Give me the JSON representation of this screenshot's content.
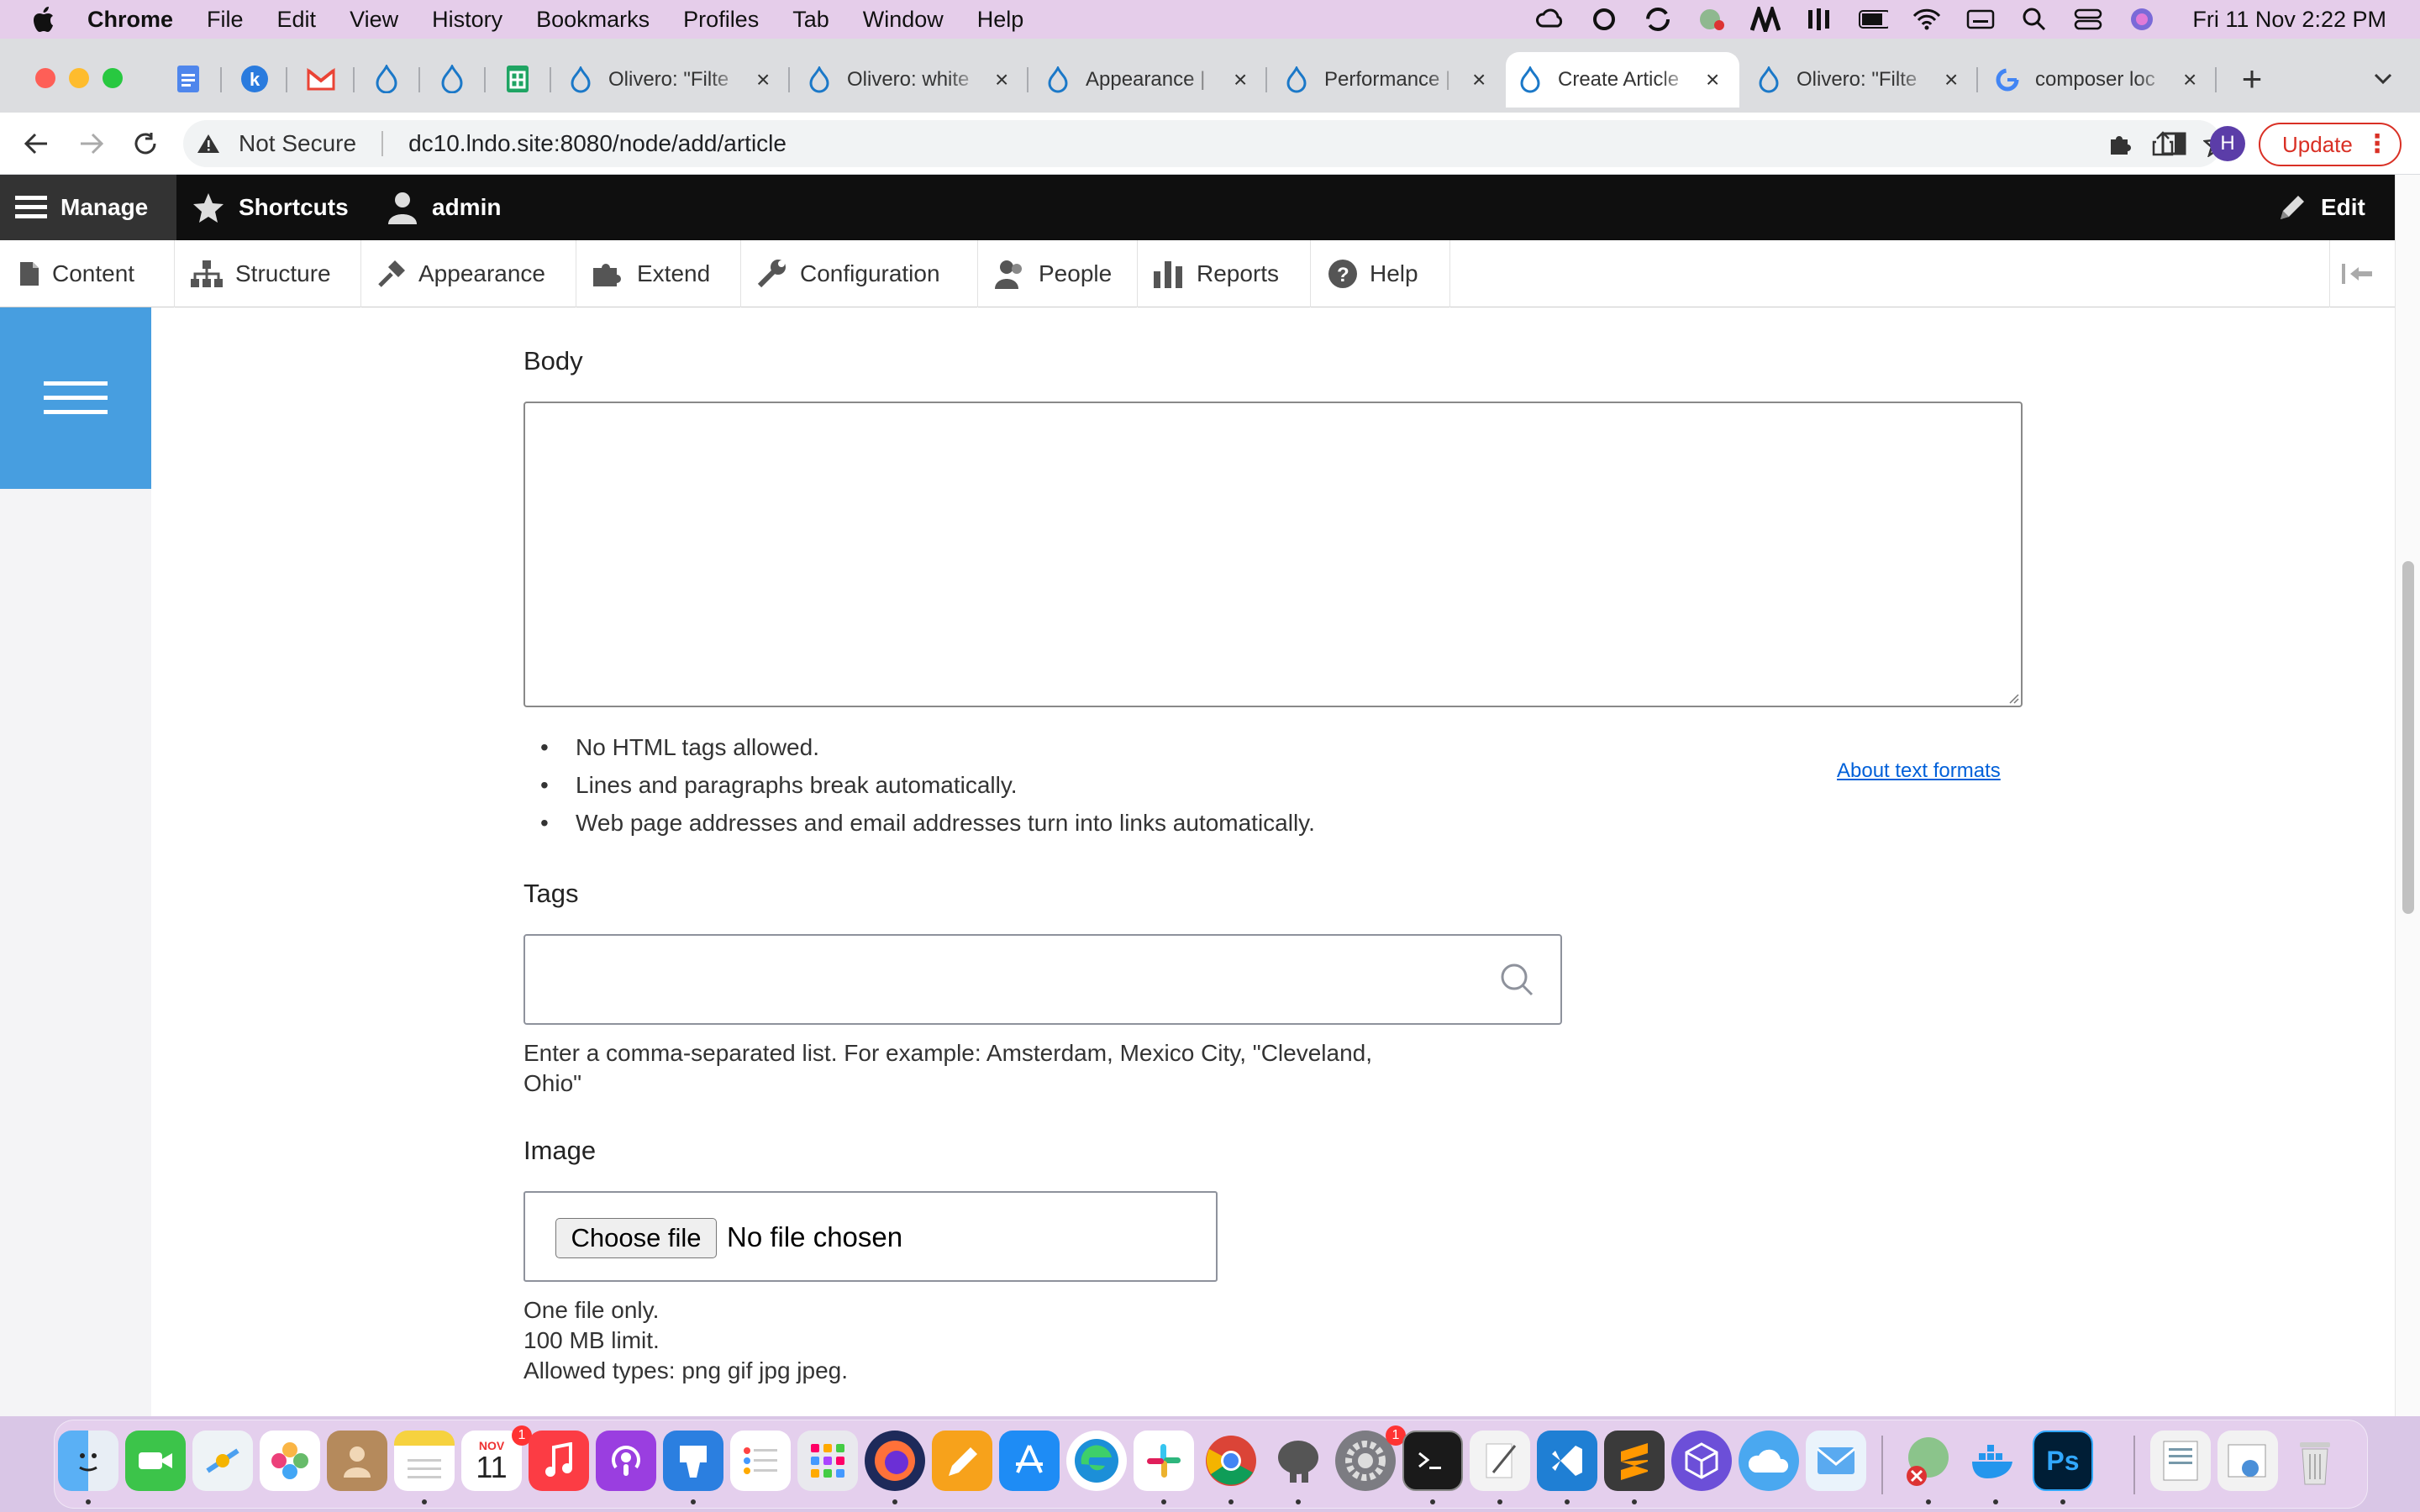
{
  "menubar": {
    "app": "Chrome",
    "items": [
      "File",
      "Edit",
      "View",
      "History",
      "Bookmarks",
      "Profiles",
      "Tab",
      "Window",
      "Help"
    ],
    "clock": "Fri 11 Nov  2:22 PM"
  },
  "tabs": [
    {
      "title": "Olivero: \"Filte",
      "icon": "drupal-icon"
    },
    {
      "title": "Olivero: white",
      "icon": "drupal-icon"
    },
    {
      "title": "Appearance |",
      "icon": "drupal-icon"
    },
    {
      "title": "Performance |",
      "icon": "drupal-icon"
    },
    {
      "title": "Create Article",
      "icon": "drupal-icon",
      "active": true
    },
    {
      "title": "Olivero: \"Filte",
      "icon": "drupal-icon"
    },
    {
      "title": "composer loc",
      "icon": "google-icon"
    }
  ],
  "omnibox": {
    "security": "Not Secure",
    "url": "dc10.lndo.site:8080/node/add/article"
  },
  "profile_initial": "H",
  "update_label": "Update",
  "drupal_toolbar": {
    "manage": "Manage",
    "shortcuts": "Shortcuts",
    "user": "admin",
    "edit": "Edit"
  },
  "tray": [
    "Content",
    "Structure",
    "Appearance",
    "Extend",
    "Configuration",
    "People",
    "Reports",
    "Help"
  ],
  "form": {
    "body_label": "Body",
    "format_tips": [
      "No HTML tags allowed.",
      "Lines and paragraphs break automatically.",
      "Web page addresses and email addresses turn into links automatically."
    ],
    "about_formats": "About text formats",
    "tags_label": "Tags",
    "tags_help_line1": "Enter a comma-separated list. For example: Amsterdam, Mexico City, \"Cleveland,",
    "tags_help_line2": "Ohio\"",
    "image_label": "Image",
    "choose_file": "Choose file",
    "no_file": "No file chosen",
    "image_help": [
      "One file only.",
      "100 MB limit.",
      "Allowed types: png gif jpg jpeg."
    ]
  },
  "dock": {
    "calendar_month": "NOV",
    "calendar_day": "11",
    "badge": "1"
  },
  "colors": {
    "drupal_blue": "#479ee0",
    "toolbar_black": "#0f0f0f",
    "link_blue": "#0060d9",
    "update_red": "#d93025"
  }
}
